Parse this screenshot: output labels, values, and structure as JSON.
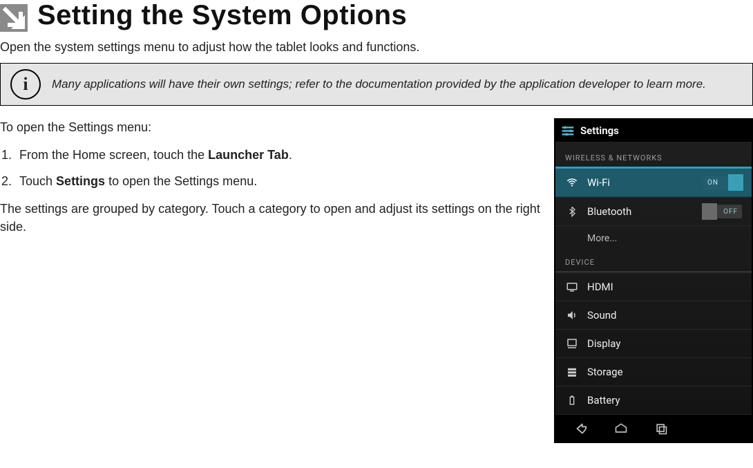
{
  "page": {
    "title": "Setting the System Options",
    "intro": "Open the system settings menu to adjust how the tablet looks and functions."
  },
  "callout": {
    "icon_glyph": "i",
    "text": "Many applications will have their own settings; refer to the documentation provided by the application developer to learn more."
  },
  "body": {
    "lead": "To open the Settings menu:",
    "step1_prefix": "From the Home screen, touch the ",
    "step1_bold": "Launcher Tab",
    "step1_suffix": ".",
    "step2_prefix": "Touch ",
    "step2_bold": "Settings",
    "step2_suffix": " to open the Settings menu.",
    "para2": "The settings are grouped by category. Touch a category to open and adjust its set­tings on the right side."
  },
  "phone": {
    "title": "Settings",
    "sections": {
      "wireless_label": "WIRELESS & NETWORKS",
      "device_label": "DEVICE"
    },
    "rows": {
      "wifi": {
        "label": "Wi-Fi",
        "toggle": "ON"
      },
      "bluetooth": {
        "label": "Bluetooth",
        "toggle": "OFF"
      },
      "more": {
        "label": "More..."
      },
      "hdmi": {
        "label": "HDMI"
      },
      "sound": {
        "label": "Sound"
      },
      "display": {
        "label": "Display"
      },
      "storage": {
        "label": "Storage"
      },
      "battery": {
        "label": "Battery"
      }
    }
  }
}
